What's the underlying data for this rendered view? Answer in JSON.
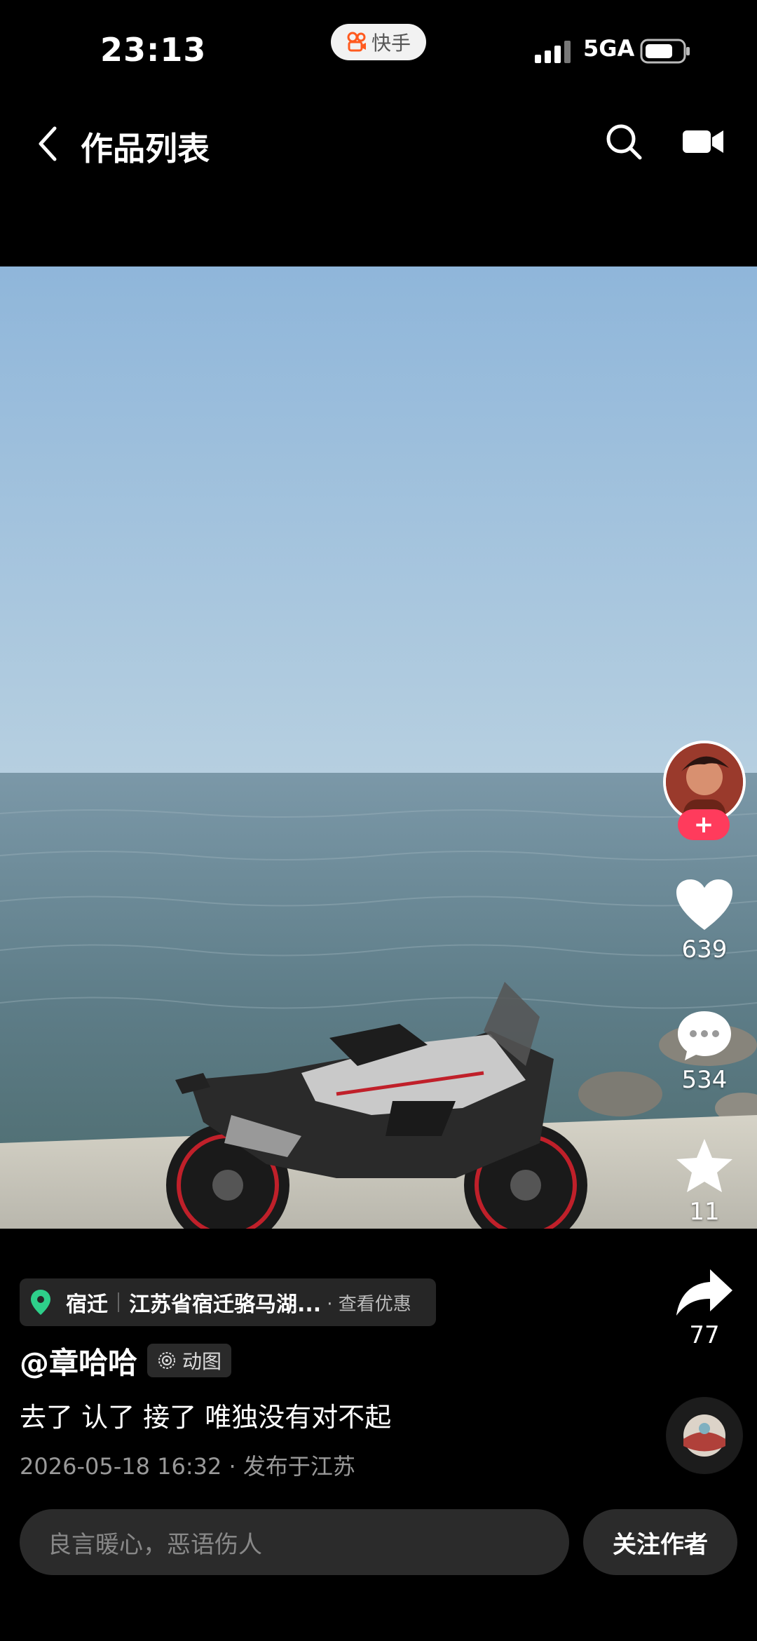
{
  "status_bar": {
    "time": "23:13",
    "app_pill_label": "快手",
    "network": "5GA",
    "icons": [
      "signal-icon",
      "battery-icon",
      "kuaishou-icon"
    ]
  },
  "header": {
    "title": "作品列表",
    "icons": [
      "back-arrow-icon",
      "search-icon",
      "camera-icon"
    ]
  },
  "rail": {
    "like_count": "639",
    "comment_count": "534",
    "favorite_count": "11",
    "share_count": "77",
    "follow_plus": "+",
    "icons": [
      "heart-icon",
      "comment-icon",
      "star-icon",
      "share-icon",
      "music-disc-icon"
    ]
  },
  "location": {
    "city": "宿迁",
    "address": "江苏省宿迁骆马湖...",
    "offer": "· 查看优惠"
  },
  "post": {
    "author": "@章哈哈",
    "tag": "动图",
    "caption": "去了 认了 接了 唯独没有对不起",
    "meta": "2026-05-18 16:32 · 发布于江苏"
  },
  "footer": {
    "comment_placeholder": "良言暖心，恶语伤人",
    "follow_button": "关注作者"
  },
  "colors": {
    "background": "#000000",
    "accent_pink": "#ff3b5c",
    "location_pin": "#2ecf8a",
    "sky": "#9ec1df",
    "sea": "#5b7a86"
  }
}
